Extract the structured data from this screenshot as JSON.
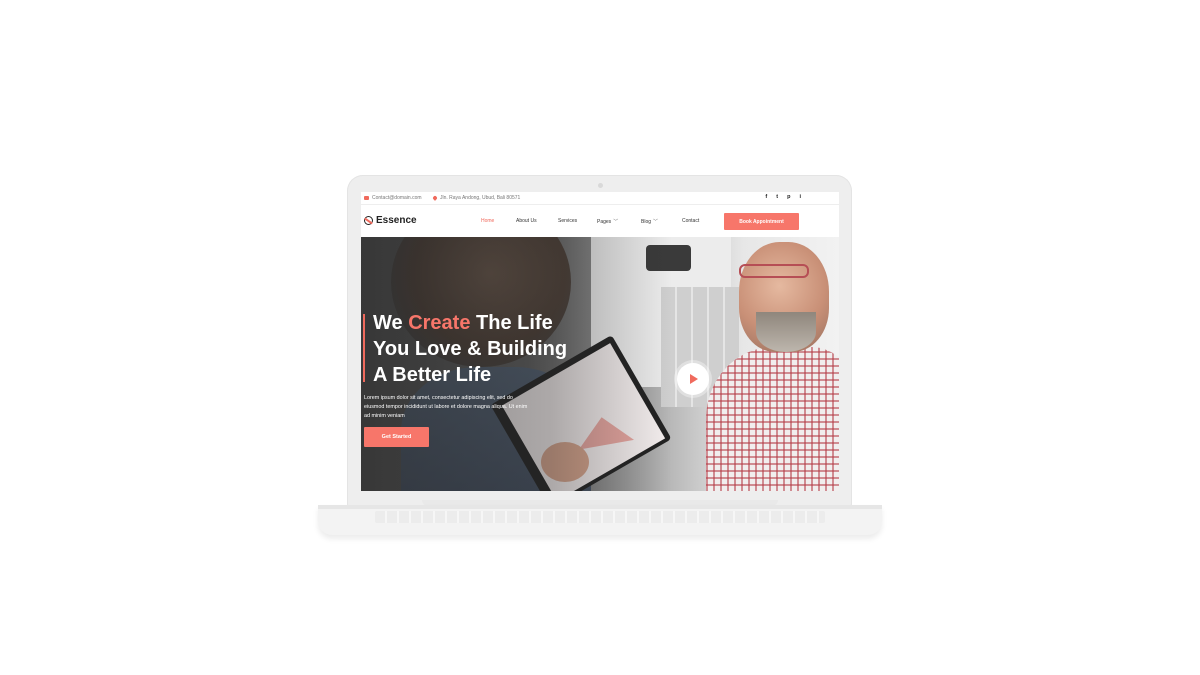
{
  "topbar": {
    "email": "Contact@domain.com",
    "address": "Jln. Raya Andong, Ubud, Bali 80571",
    "socials": [
      "f",
      "t",
      "p",
      "i"
    ]
  },
  "brand": {
    "name": "Essence"
  },
  "nav": {
    "items": [
      {
        "label": "Home",
        "active": true
      },
      {
        "label": "About Us"
      },
      {
        "label": "Services"
      },
      {
        "label": "Pages",
        "dropdown": true
      },
      {
        "label": "Blog",
        "dropdown": true
      },
      {
        "label": "Contact"
      }
    ],
    "cta_label": "Book Appointment"
  },
  "hero": {
    "headline_part1": "We ",
    "headline_accent": "Create",
    "headline_part2": " The Life",
    "headline_line2": "You Love & Building",
    "headline_line3": "A Better Life",
    "body": "Lorem ipsum dolor sit amet, consectetur adipiscing elit, sed do eiusmod tempor incididunt ut labore et dolore magna aliqua. Ut enim ad minim veniam",
    "cta_label": "Get Started"
  },
  "colors": {
    "accent": "#f06a5d",
    "button": "#f7766a",
    "text_dark": "#222222"
  },
  "icons": {
    "email": "envelope-icon",
    "address": "map-pin-icon",
    "play": "play-icon"
  }
}
